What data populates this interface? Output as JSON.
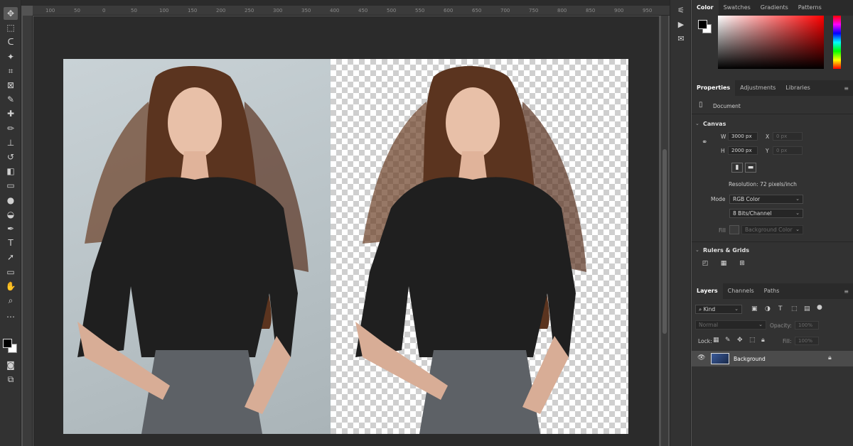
{
  "ruler": {
    "ticks": [
      "100",
      "50",
      "0",
      "50",
      "100",
      "150",
      "200",
      "250",
      "300",
      "350",
      "400",
      "450",
      "500",
      "550",
      "600",
      "650",
      "700",
      "750",
      "800",
      "850",
      "900",
      "950"
    ]
  },
  "toolbar": {
    "tools": [
      {
        "name": "move-tool-icon",
        "glyph": "✥"
      },
      {
        "name": "marquee-tool-icon",
        "glyph": "⬚"
      },
      {
        "name": "lasso-tool-icon",
        "glyph": "ᑕ"
      },
      {
        "name": "magic-wand-tool-icon",
        "glyph": "✦"
      },
      {
        "name": "crop-tool-icon",
        "glyph": "⌗"
      },
      {
        "name": "frame-tool-icon",
        "glyph": "⊠"
      },
      {
        "name": "eyedropper-tool-icon",
        "glyph": "✎"
      },
      {
        "name": "healing-brush-tool-icon",
        "glyph": "✚"
      },
      {
        "name": "brush-tool-icon",
        "glyph": "✏"
      },
      {
        "name": "clone-stamp-tool-icon",
        "glyph": "⊥"
      },
      {
        "name": "history-brush-tool-icon",
        "glyph": "↺"
      },
      {
        "name": "eraser-tool-icon",
        "glyph": "◧"
      },
      {
        "name": "gradient-tool-icon",
        "glyph": "▭"
      },
      {
        "name": "blur-tool-icon",
        "glyph": "●"
      },
      {
        "name": "dodge-tool-icon",
        "glyph": "◒"
      },
      {
        "name": "pen-tool-icon",
        "glyph": "✒"
      },
      {
        "name": "type-tool-icon",
        "glyph": "T"
      },
      {
        "name": "path-selection-tool-icon",
        "glyph": "➚"
      },
      {
        "name": "rectangle-tool-icon",
        "glyph": "▭"
      },
      {
        "name": "hand-tool-icon",
        "glyph": "✋"
      },
      {
        "name": "zoom-tool-icon",
        "glyph": "⌕"
      },
      {
        "name": "more-tools-icon",
        "glyph": "…"
      }
    ]
  },
  "midstrip": {
    "icons": [
      {
        "name": "history-panel-icon",
        "glyph": "⚟"
      },
      {
        "name": "actions-play-icon",
        "glyph": "▶"
      },
      {
        "name": "comments-icon",
        "glyph": "✉"
      }
    ]
  },
  "color_panel": {
    "tabs": [
      "Color",
      "Swatches",
      "Gradients",
      "Patterns"
    ],
    "active_tab": "Color",
    "accent": "#ff0000"
  },
  "properties_panel": {
    "tabs": [
      "Properties",
      "Adjustments",
      "Libraries"
    ],
    "active_tab": "Properties",
    "document_label": "Document",
    "canvas": {
      "heading": "Canvas",
      "w_label": "W",
      "w_value": "3000 px",
      "h_label": "H",
      "h_value": "2000 px",
      "x_label": "X",
      "x_value": "0 px",
      "y_label": "Y",
      "y_value": "0 px",
      "resolution": "Resolution: 72 pixels/inch",
      "mode_label": "Mode",
      "mode_value": "RGB Color",
      "bits_value": "8 Bits/Channel",
      "fill_label": "Fill",
      "fill_value": "Background Color"
    },
    "rulers_heading": "Rulers & Grids"
  },
  "layers_panel": {
    "tabs": [
      "Layers",
      "Channels",
      "Paths"
    ],
    "active_tab": "Layers",
    "kind_label": "Kind",
    "blend_mode": "Normal",
    "opacity_label": "Opacity:",
    "opacity_value": "100%",
    "lock_label": "Lock:",
    "fill_label": "Fill:",
    "fill_value": "100%",
    "layer_name": "Background"
  }
}
